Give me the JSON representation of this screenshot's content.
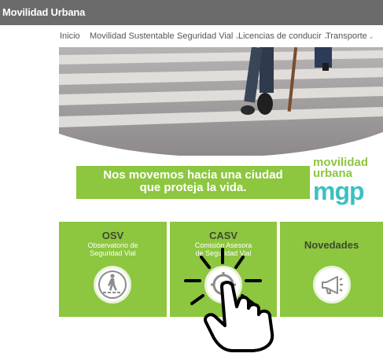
{
  "header": {
    "brand": "Movilidad Urbana"
  },
  "nav": {
    "items": [
      {
        "label": "Inicio",
        "dropdown": false
      },
      {
        "label": "Movilidad Sustentable",
        "dropdown": true
      },
      {
        "label": "Seguridad Vial",
        "dropdown": true
      },
      {
        "label": "Licencias de conducir",
        "dropdown": true
      },
      {
        "label": "Transporte",
        "dropdown": true
      }
    ]
  },
  "banner": {
    "line1": "Nos movemos hacia una ciudad",
    "line2": "que proteja la vida."
  },
  "logo": {
    "word1": "movilidad",
    "word2": "urbana",
    "word3": "mgp"
  },
  "cards": [
    {
      "title": "OSV",
      "subtitle_line1": "Observatorio de",
      "subtitle_line2": "Seguridad Vial",
      "icon": "pedestrian-crossing-icon"
    },
    {
      "title": "CASV",
      "subtitle_line1": "Comisión Asesora",
      "subtitle_line2": "de Seguridad Vial",
      "icon": "roundabout-icon"
    },
    {
      "title": "Novedades",
      "subtitle_line1": "",
      "subtitle_line2": "",
      "icon": "megaphone-icon"
    }
  ],
  "colors": {
    "accent_green": "#8dc63f",
    "brand_teal": "#3cc0c0",
    "topbar": "#6b6b6b"
  },
  "overlay": {
    "icon": "pointing-hand-cursor-icon"
  }
}
